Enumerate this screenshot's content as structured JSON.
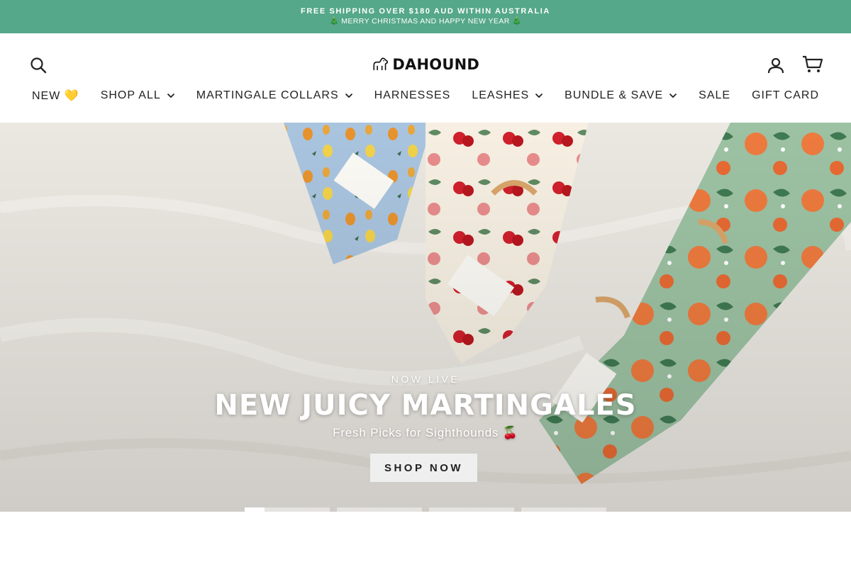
{
  "announcement": {
    "line1": "FREE SHIPPING OVER $180 AUD WITHIN AUSTRALIA",
    "line2": "🎄 MERRY CHRISTMAS AND HAPPY NEW YEAR 🎄"
  },
  "header": {
    "logo_text": "DAHOUND",
    "icons": [
      "search-icon",
      "account-icon",
      "cart-icon"
    ]
  },
  "nav": {
    "items": [
      {
        "label": "NEW 💛",
        "has_dropdown": false
      },
      {
        "label": "SHOP ALL",
        "has_dropdown": true
      },
      {
        "label": "MARTINGALE COLLARS",
        "has_dropdown": true
      },
      {
        "label": "HARNESSES",
        "has_dropdown": false
      },
      {
        "label": "LEASHES",
        "has_dropdown": true
      },
      {
        "label": "BUNDLE & SAVE",
        "has_dropdown": true
      },
      {
        "label": "SALE",
        "has_dropdown": false
      },
      {
        "label": "GIFT CARD",
        "has_dropdown": false
      }
    ]
  },
  "hero": {
    "eyebrow": "NOW LIVE",
    "headline": "NEW JUICY MARTINGALES",
    "subline": "Fresh Picks for Sighthounds 🍒",
    "cta_label": "SHOP NOW",
    "slides": 4,
    "active_slide": 1,
    "active_progress": 0.23
  },
  "colors": {
    "announcement_bg": "#55a889",
    "text": "#222222",
    "button_bg": "#efefef"
  }
}
